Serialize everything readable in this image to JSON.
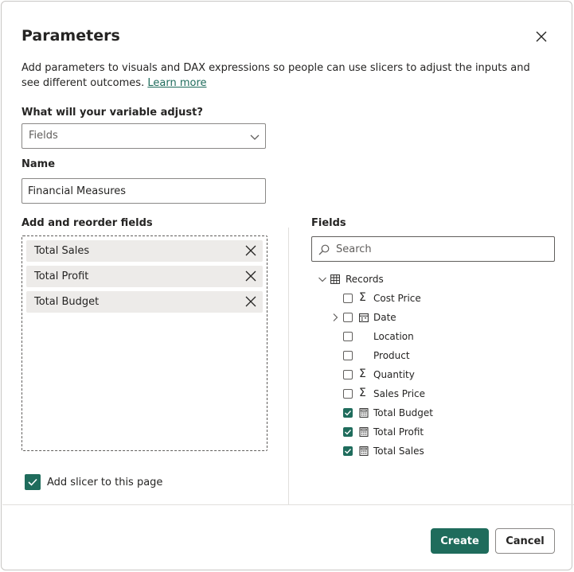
{
  "dialog": {
    "title": "Parameters",
    "description": "Add parameters to visuals and DAX expressions so people can use slicers to adjust the inputs and see different outcomes.",
    "learn_more": "Learn more"
  },
  "adjust": {
    "label": "What will your variable adjust?",
    "value": "Fields"
  },
  "name": {
    "label": "Name",
    "value": "Financial Measures"
  },
  "reorder": {
    "label": "Add and reorder fields",
    "chips": [
      "Total Sales",
      "Total Profit",
      "Total Budget"
    ]
  },
  "slicer": {
    "label": "Add slicer to this page",
    "checked": true
  },
  "fields": {
    "label": "Fields",
    "search_placeholder": "Search",
    "table": "Records",
    "items": [
      {
        "label": "Cost Price",
        "icon": "sigma-icon",
        "checked": false
      },
      {
        "label": "Date",
        "icon": "calendar-icon",
        "checked": false,
        "expandable": true
      },
      {
        "label": "Location",
        "icon": "",
        "checked": false
      },
      {
        "label": "Product",
        "icon": "",
        "checked": false
      },
      {
        "label": "Quantity",
        "icon": "sigma-icon",
        "checked": false
      },
      {
        "label": "Sales Price",
        "icon": "sigma-icon",
        "checked": false
      },
      {
        "label": "Total Budget",
        "icon": "calculator-icon",
        "checked": true
      },
      {
        "label": "Total Profit",
        "icon": "calculator-icon",
        "checked": true
      },
      {
        "label": "Total Sales",
        "icon": "calculator-icon",
        "checked": true
      }
    ]
  },
  "buttons": {
    "create": "Create",
    "cancel": "Cancel"
  },
  "colors": {
    "accent": "#1f6c5c",
    "chip_bg": "#edebe9"
  }
}
